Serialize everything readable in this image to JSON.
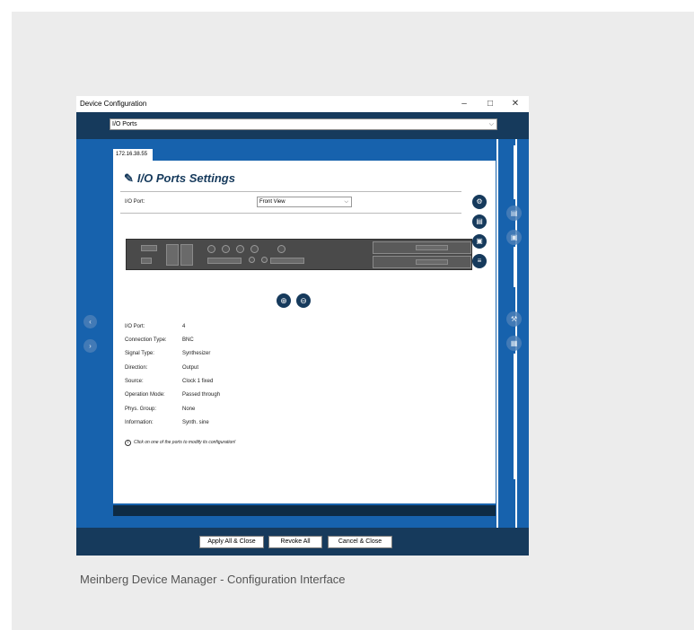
{
  "window": {
    "title": "Device Configuration",
    "minimize": "–",
    "maximize": "□",
    "close": "✕"
  },
  "top_dropdown": {
    "value": "I/O Ports"
  },
  "tab": {
    "label": "172.16.38.55"
  },
  "panel": {
    "heading": "I/O Ports Settings",
    "io_port_label": "I/O Port:",
    "view_select": "Front View"
  },
  "details": [
    {
      "key": "I/O Port:",
      "value": "4"
    },
    {
      "key": "Connection Type:",
      "value": "BNC"
    },
    {
      "key": "Signal Type:",
      "value": "Synthesizer"
    },
    {
      "key": "Direction:",
      "value": "Output"
    },
    {
      "key": "Source:",
      "value": "Clock 1 fixed"
    },
    {
      "key": "Operation Mode:",
      "value": "Passed through"
    },
    {
      "key": "Phys. Group:",
      "value": "None"
    },
    {
      "key": "Information:",
      "value": "Synth. sine"
    }
  ],
  "info_text": "Click on one of the ports to modify its configuration!",
  "buttons": {
    "apply": "Apply All & Close",
    "revoke": "Revoke All",
    "cancel": "Cancel & Close"
  },
  "caption": "Meinberg Device Manager - Configuration Interface",
  "icons": {
    "wrench": "wrench-icon",
    "zoom_in": "zoom-in-icon",
    "zoom_out": "zoom-out-icon",
    "info": "info-icon"
  },
  "colors": {
    "navy": "#163a5c",
    "blue": "#1762ad",
    "background": "#ececec"
  }
}
